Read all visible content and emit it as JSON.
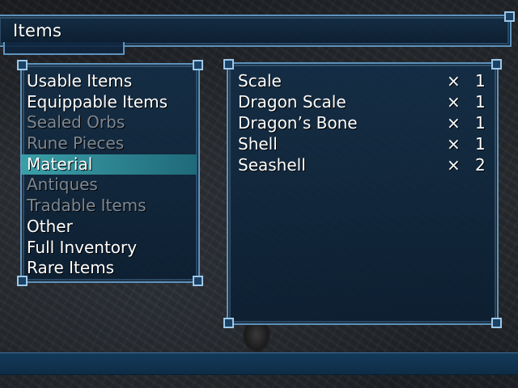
{
  "header": {
    "title": "Items"
  },
  "categories": [
    {
      "label": "Usable Items",
      "state": "enabled"
    },
    {
      "label": "Equippable Items",
      "state": "enabled"
    },
    {
      "label": "Sealed Orbs",
      "state": "disabled"
    },
    {
      "label": "Rune Pieces",
      "state": "disabled"
    },
    {
      "label": "Material",
      "state": "selected"
    },
    {
      "label": "Antiques",
      "state": "disabled"
    },
    {
      "label": "Tradable Items",
      "state": "disabled"
    },
    {
      "label": "Other",
      "state": "enabled"
    },
    {
      "label": "Full Inventory",
      "state": "enabled"
    },
    {
      "label": "Rare Items",
      "state": "enabled"
    }
  ],
  "items": [
    {
      "name": "Scale",
      "multiplier": "×",
      "quantity": "1"
    },
    {
      "name": "Dragon Scale",
      "multiplier": "×",
      "quantity": "1"
    },
    {
      "name": "Dragon’s Bone",
      "multiplier": "×",
      "quantity": "1"
    },
    {
      "name": "Shell",
      "multiplier": "×",
      "quantity": "1"
    },
    {
      "name": "Seashell",
      "multiplier": "×",
      "quantity": "2"
    }
  ],
  "colors": {
    "panel_border": "#5f93bd",
    "selection_highlight": "#2b7f8c",
    "enabled_text": "#ffffff",
    "disabled_text": "#7d8790"
  }
}
